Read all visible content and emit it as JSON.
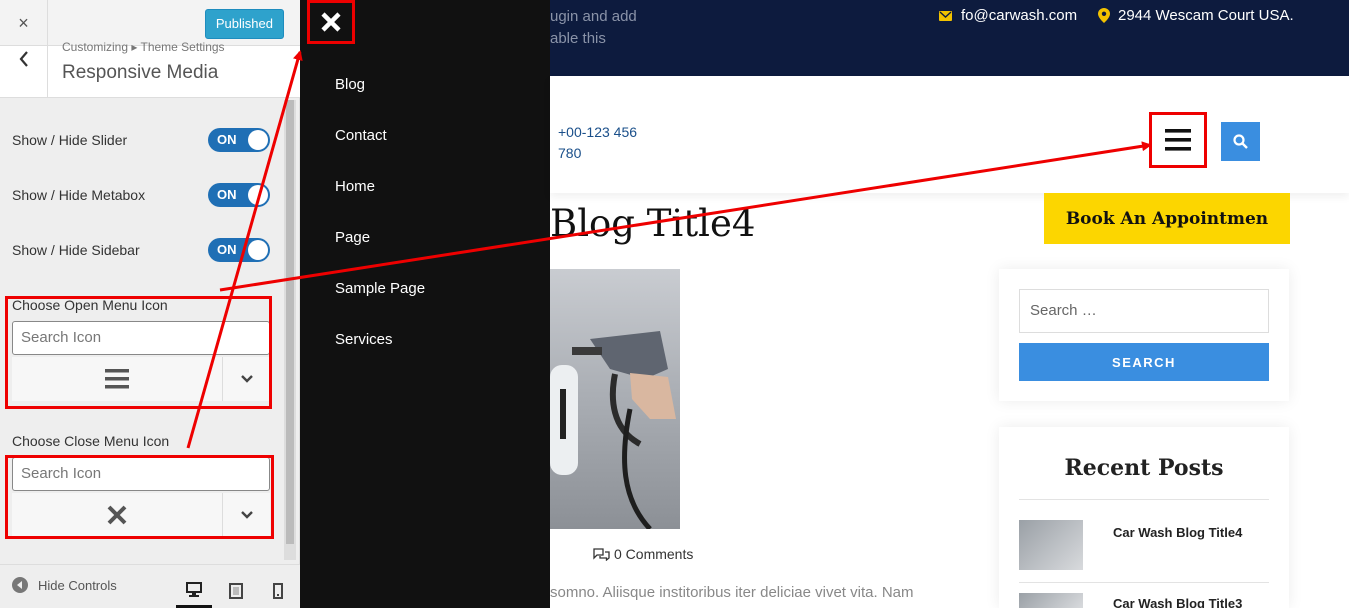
{
  "customizer": {
    "close_label": "×",
    "publish_label": "Published",
    "breadcrumb": "Customizing ▸ Theme Settings",
    "section_title": "Responsive Media",
    "toggles": [
      {
        "label": "Show / Hide Slider",
        "state": "ON"
      },
      {
        "label": "Show / Hide Metabox",
        "state": "ON"
      },
      {
        "label": "Show / Hide Sidebar",
        "state": "ON"
      }
    ],
    "open_icon": {
      "label": "Choose Open Menu Icon",
      "placeholder": "Search Icon",
      "selected_icon": "bars-icon"
    },
    "close_icon": {
      "label": "Choose Close Menu Icon",
      "placeholder": "Search Icon",
      "selected_icon": "times-icon"
    },
    "footer": {
      "hide_controls": "Hide Controls",
      "devices": [
        "desktop",
        "tablet",
        "mobile"
      ],
      "active_device": "desktop"
    }
  },
  "offcanvas": {
    "items": [
      "Blog",
      "Contact",
      "Home",
      "Page",
      "Sample Page",
      "Services"
    ]
  },
  "site": {
    "topbar": {
      "notice_line1": "ugin and add",
      "notice_line2": "able this",
      "email": "fo@carwash.com",
      "address": "2944 Wescam Court USA."
    },
    "header": {
      "phone_line1": "+00-123 456",
      "phone_line2": "780"
    },
    "post": {
      "title": "Blog Title4",
      "comments": "0 Comments",
      "excerpt": "somno. Aliisque institoribus iter deliciae vivet vita. Nam"
    },
    "sidebar": {
      "appointment_label": "Book An Appointmen",
      "search_placeholder": "Search …",
      "search_button": "SEARCH",
      "recent_title": "Recent Posts",
      "recent_posts": [
        "Car Wash Blog Title4",
        "Car Wash Blog Title3"
      ]
    }
  },
  "colors": {
    "annotation_red": "#e00000",
    "toggle_blue": "#1f6fb5",
    "accent_blue": "#3a8ee0",
    "appointment_yellow": "#fcd600",
    "topbar_navy": "#0d1b3e"
  }
}
